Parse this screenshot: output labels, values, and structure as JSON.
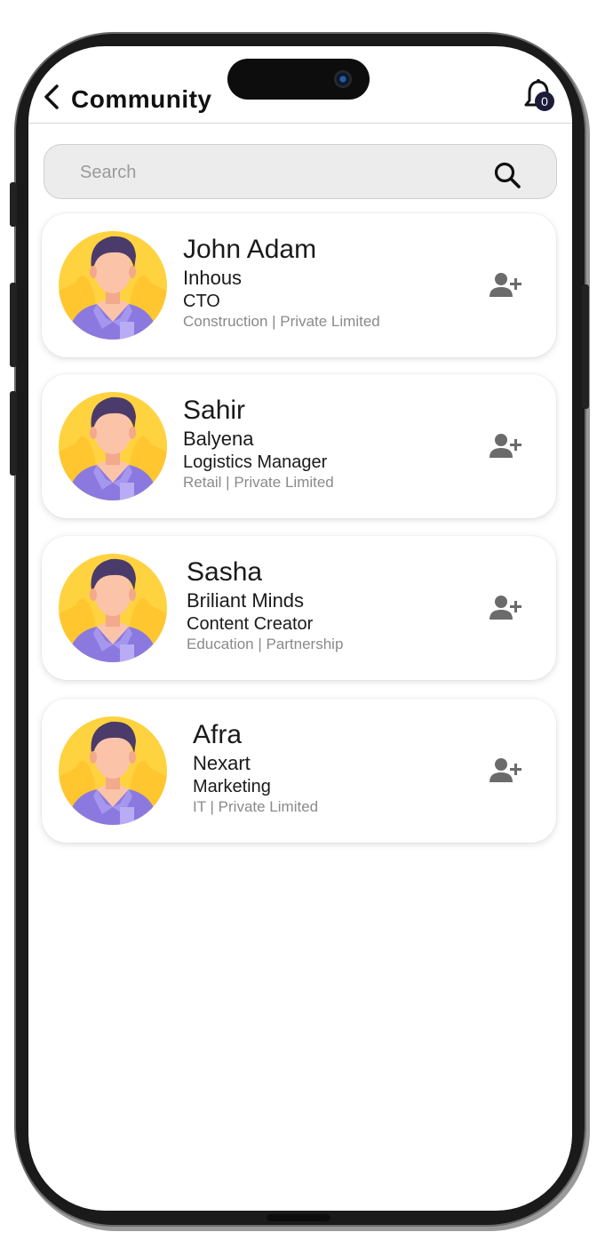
{
  "header": {
    "title": "Community",
    "back_icon": "chevron-left-icon",
    "notification_icon": "bell-icon",
    "notification_count": "0"
  },
  "search": {
    "placeholder": "Search",
    "icon": "search-icon"
  },
  "members": [
    {
      "name": "John Adam",
      "company": "Inhous",
      "role": "CTO",
      "meta": "Construction | Private Limited"
    },
    {
      "name": "Sahir",
      "company": "Balyena",
      "role": "Logistics Manager",
      "meta": "Retail | Private Limited"
    },
    {
      "name": "Sasha",
      "company": "Briliant Minds",
      "role": "Content Creator",
      "meta": "Education | Partnership"
    },
    {
      "name": "Afra",
      "company": "Nexart",
      "role": "Marketing",
      "meta": "IT | Private Limited"
    }
  ],
  "colors": {
    "avatar_bg": "#FFD23F",
    "shirt": "#8B79E0",
    "hair": "#4A3B6B",
    "skin": "#FBC3A8",
    "add_icon": "#6b6b6b"
  }
}
